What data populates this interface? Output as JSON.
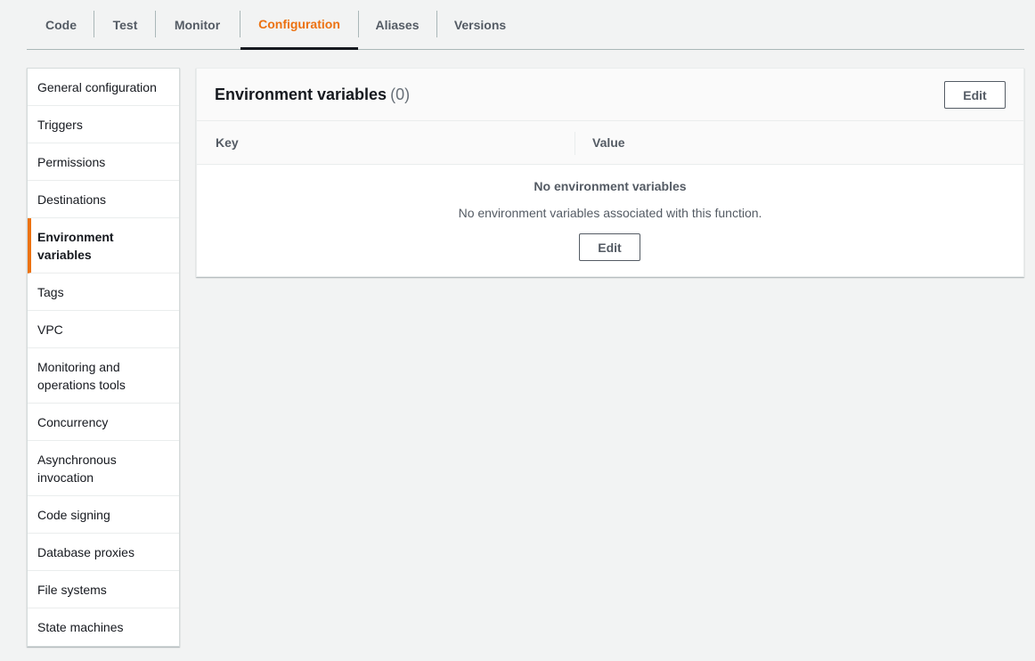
{
  "tabs": [
    {
      "label": "Code"
    },
    {
      "label": "Test"
    },
    {
      "label": "Monitor"
    },
    {
      "label": "Configuration"
    },
    {
      "label": "Aliases"
    },
    {
      "label": "Versions"
    }
  ],
  "active_tab": "Configuration",
  "sidebar": {
    "items": [
      {
        "label": "General configuration"
      },
      {
        "label": "Triggers"
      },
      {
        "label": "Permissions"
      },
      {
        "label": "Destinations"
      },
      {
        "label": "Environment variables"
      },
      {
        "label": "Tags"
      },
      {
        "label": "VPC"
      },
      {
        "label": "Monitoring and operations tools"
      },
      {
        "label": "Concurrency"
      },
      {
        "label": "Asynchronous invocation"
      },
      {
        "label": "Code signing"
      },
      {
        "label": "Database proxies"
      },
      {
        "label": "File systems"
      },
      {
        "label": "State machines"
      }
    ],
    "active_item": "Environment variables"
  },
  "panel": {
    "title": "Environment variables",
    "count": "(0)",
    "edit_label": "Edit",
    "columns": [
      "Key",
      "Value"
    ],
    "empty_title": "No environment variables",
    "empty_description": "No environment variables associated with this function.",
    "empty_edit_label": "Edit"
  },
  "colors": {
    "accent": "#ec7211",
    "background": "#f2f3f3",
    "text": "#16191f",
    "muted": "#545b64"
  }
}
